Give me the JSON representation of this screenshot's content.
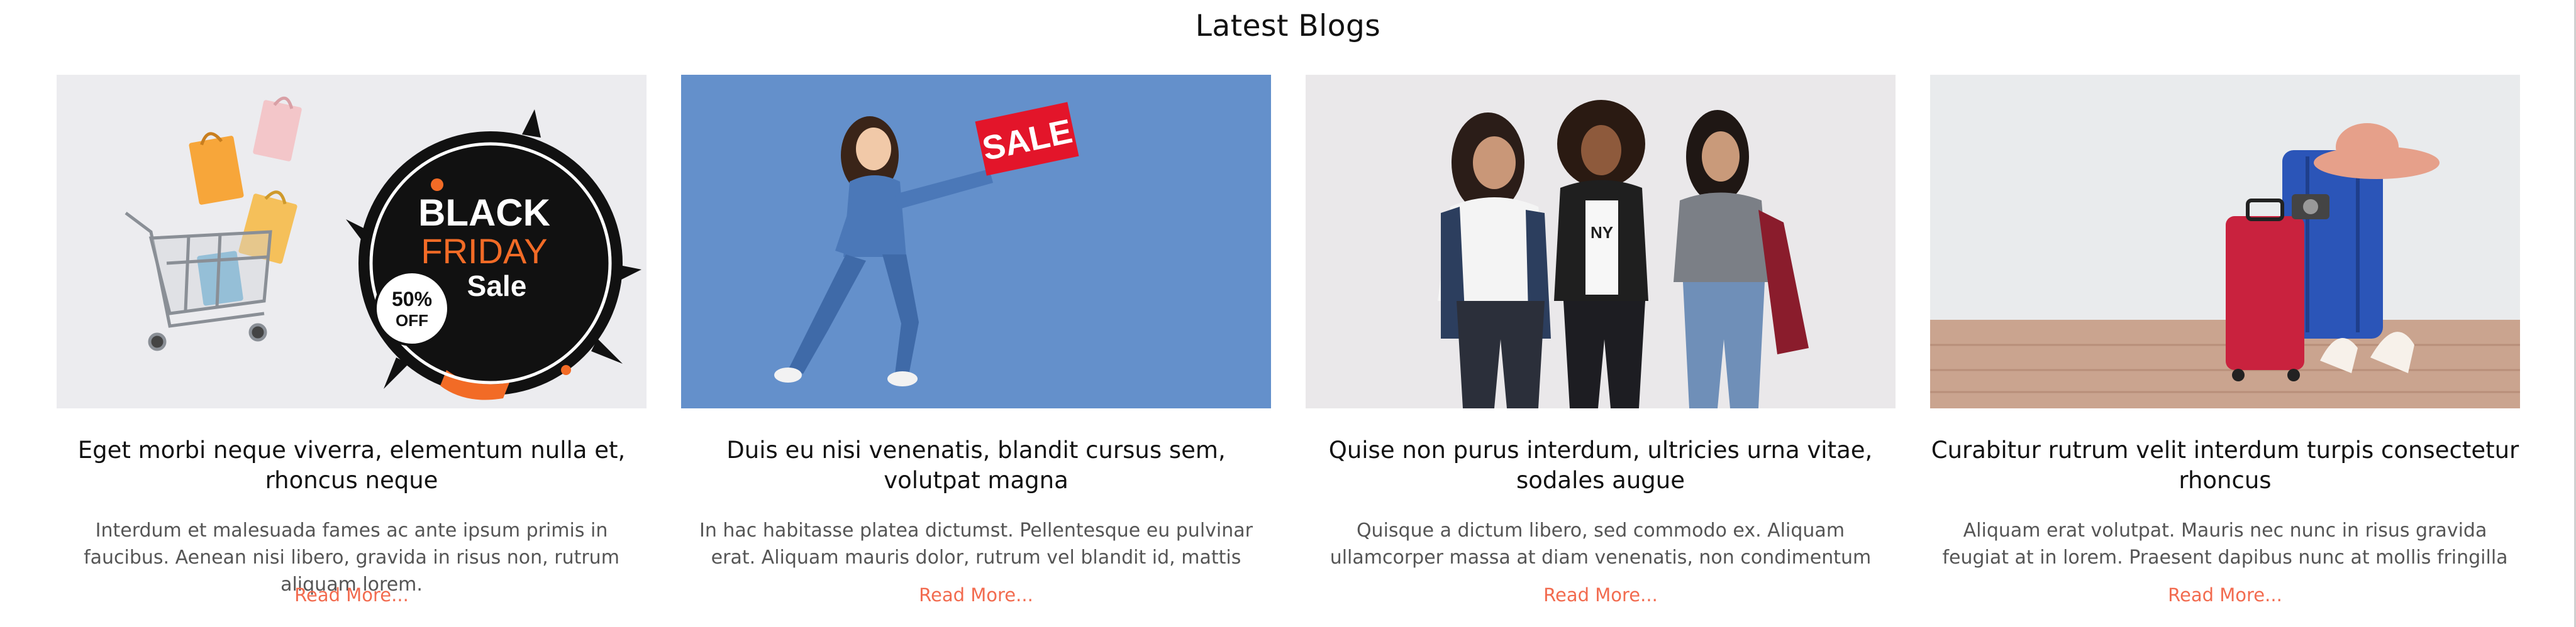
{
  "section": {
    "title": "Latest Blogs"
  },
  "colors": {
    "accent": "#f26b4f",
    "title_text": "#111111",
    "body_text": "#555555"
  },
  "posts": [
    {
      "title": "Eget morbi neque viverra, elementum nulla et, rhoncus neque",
      "excerpt": "Interdum et malesuada fames ac ante ipsum primis in faucibus. Aenean nisi libero, gravida in risus non, rutrum aliquam lorem.",
      "read_more": "Read More...",
      "image": {
        "badge_line1": "BLACK",
        "badge_line2": "FRIDAY",
        "badge_line3": "Sale",
        "discount_line1": "50%",
        "discount_line2": "OFF"
      }
    },
    {
      "title": "Duis eu nisi venenatis, blandit cursus sem, volutpat magna",
      "excerpt": "In hac habitasse platea dictumst. Pellentesque eu pulvinar erat. Aliquam mauris dolor, rutrum vel blandit id, mattis",
      "read_more": "Read More...",
      "image": {
        "sign_text": "SALE"
      }
    },
    {
      "title": "Quise non purus interdum, ultricies urna vitae, sodales augue",
      "excerpt": "Quisque a dictum libero, sed commodo ex. Aliquam ullamcorper massa at diam venenatis, non condimentum",
      "read_more": "Read More...",
      "image": {}
    },
    {
      "title": "Curabitur rutrum velit interdum turpis consectetur rhoncus",
      "excerpt": "Aliquam erat volutpat. Mauris nec nunc in risus gravida feugiat at in lorem. Praesent dapibus nunc at mollis fringilla",
      "read_more": "Read More...",
      "image": {}
    }
  ]
}
